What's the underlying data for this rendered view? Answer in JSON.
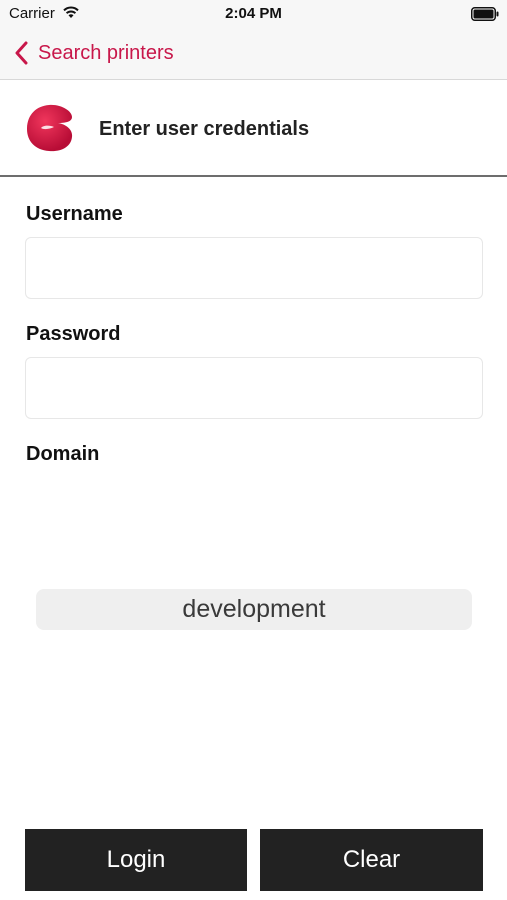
{
  "status_bar": {
    "carrier": "Carrier",
    "time": "2:04 PM"
  },
  "nav": {
    "back_label": "Search printers",
    "accent_color": "#c8174a"
  },
  "header": {
    "title": "Enter user credentials"
  },
  "form": {
    "username_label": "Username",
    "username_value": "",
    "password_label": "Password",
    "password_value": "",
    "domain_label": "Domain",
    "domain_selected": "development"
  },
  "actions": {
    "login_label": "Login",
    "clear_label": "Clear"
  },
  "icons": {
    "status_wifi": "wifi-icon",
    "status_battery": "battery-icon",
    "back": "chevron-left-icon",
    "brand": "brand-logo"
  }
}
